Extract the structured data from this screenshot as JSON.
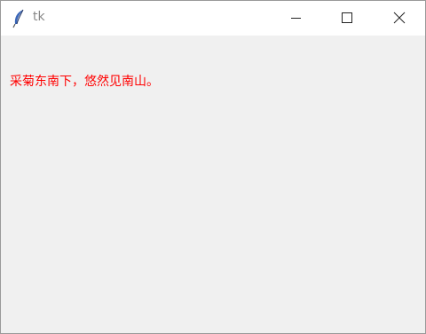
{
  "window": {
    "title": "tk",
    "controls": {
      "minimize_icon": "minimize-icon",
      "maximize_icon": "maximize-icon",
      "close_icon": "close-icon"
    }
  },
  "content": {
    "label_text": "采菊东南下，悠然见南山。",
    "label_color": "#ff0000"
  }
}
